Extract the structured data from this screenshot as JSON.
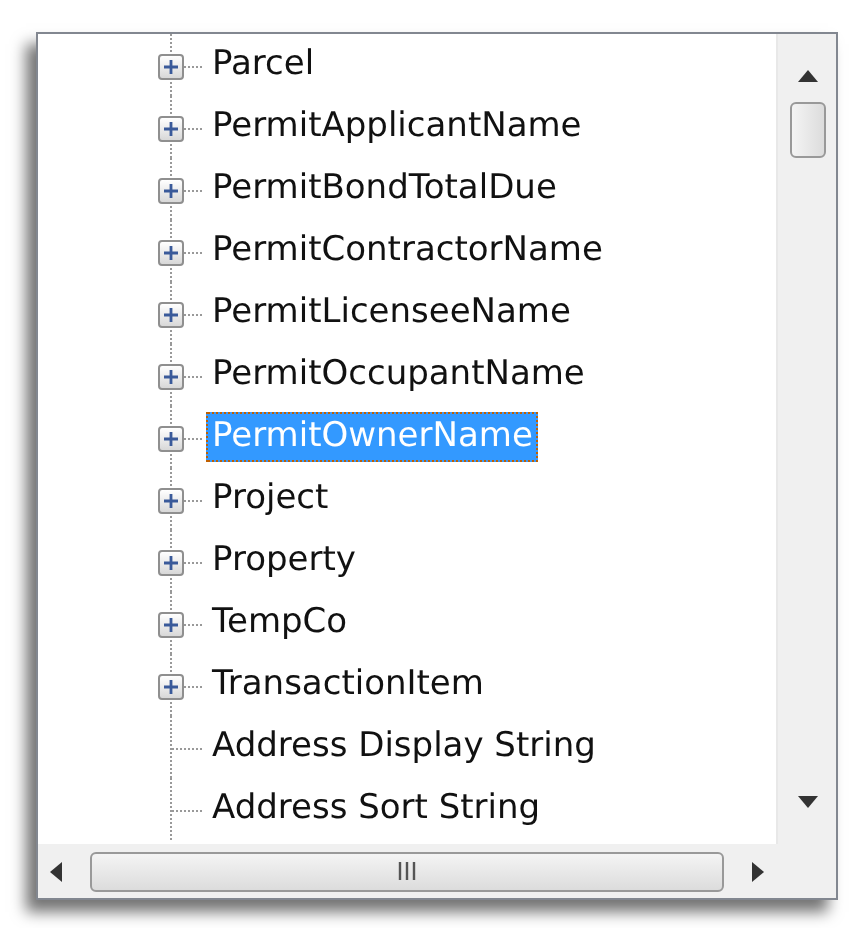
{
  "tree": {
    "items": [
      {
        "label": "Parcel",
        "kind": "expandable",
        "expanded": false,
        "selected": false
      },
      {
        "label": "PermitApplicantName",
        "kind": "expandable",
        "expanded": false,
        "selected": false
      },
      {
        "label": "PermitBondTotalDue",
        "kind": "expandable",
        "expanded": false,
        "selected": false
      },
      {
        "label": "PermitContractorName",
        "kind": "expandable",
        "expanded": false,
        "selected": false
      },
      {
        "label": "PermitLicenseeName",
        "kind": "expandable",
        "expanded": false,
        "selected": false
      },
      {
        "label": "PermitOccupantName",
        "kind": "expandable",
        "expanded": false,
        "selected": false
      },
      {
        "label": "PermitOwnerName",
        "kind": "expandable",
        "expanded": false,
        "selected": true
      },
      {
        "label": "Project",
        "kind": "expandable",
        "expanded": false,
        "selected": false
      },
      {
        "label": "Property",
        "kind": "expandable",
        "expanded": false,
        "selected": false
      },
      {
        "label": "TempCo",
        "kind": "expandable",
        "expanded": false,
        "selected": false
      },
      {
        "label": "TransactionItem",
        "kind": "expandable",
        "expanded": false,
        "selected": false
      },
      {
        "label": "Address Display String",
        "kind": "leaf",
        "selected": false
      },
      {
        "label": "Address Sort String",
        "kind": "leaf",
        "selected": false
      }
    ]
  }
}
